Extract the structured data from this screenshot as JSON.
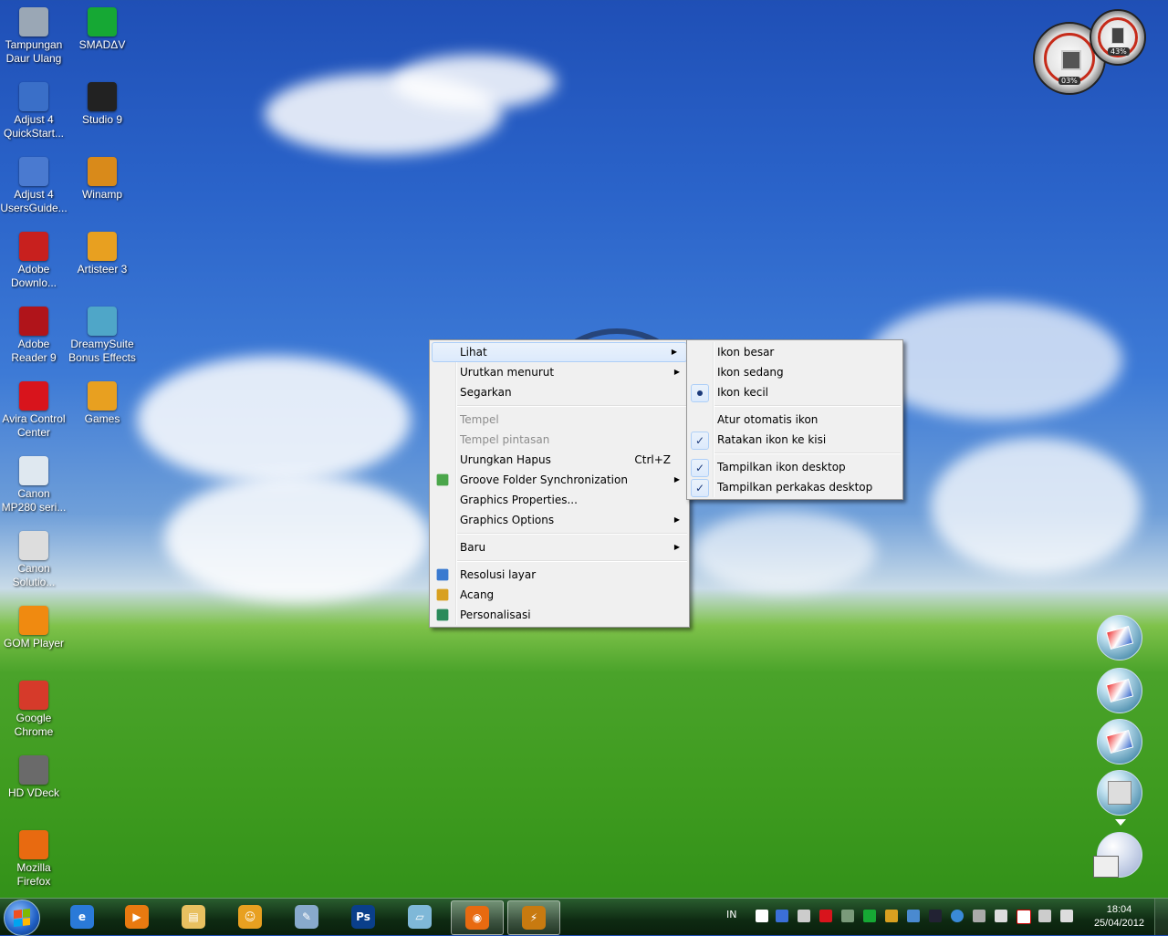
{
  "desktop_icons": [
    {
      "label": "Tampungan Daur Ulang",
      "icon": "recycle-bin-icon",
      "color": "#9aa7b5"
    },
    {
      "label": "SMADΔV",
      "icon": "smadav-icon",
      "color": "#16a834"
    },
    {
      "label": "Adjust 4 QuickStart...",
      "icon": "document-shortcut-icon",
      "color": "#3a6fc8"
    },
    {
      "label": "Studio 9",
      "icon": "clapperboard-icon",
      "color": "#222222"
    },
    {
      "label": "Adjust 4 UsersGuide...",
      "icon": "document-shortcut-icon",
      "color": "#4a7ad0"
    },
    {
      "label": "Winamp",
      "icon": "winamp-icon",
      "color": "#d98a1a"
    },
    {
      "label": "Adobe Downlo...",
      "icon": "adobe-download-icon",
      "color": "#c8201e"
    },
    {
      "label": "Artisteer 3",
      "icon": "palette-icon",
      "color": "#e8a020"
    },
    {
      "label": "Adobe Reader 9",
      "icon": "adobe-reader-icon",
      "color": "#b0141a"
    },
    {
      "label": "DreamySuite Bonus Effects",
      "icon": "dreamysuite-icon",
      "color": "#4fa6c8"
    },
    {
      "label": "Avira Control Center",
      "icon": "avira-icon",
      "color": "#d8141c"
    },
    {
      "label": "Games",
      "icon": "games-icon",
      "color": "#e8a020"
    },
    {
      "label": "Canon MP280 seri...",
      "icon": "canon-printer-icon",
      "color": "#dfe8f0"
    },
    {
      "label": "Canon Solutio...",
      "icon": "canon-solution-icon",
      "color": "#dddddd"
    },
    {
      "label": "GOM Player",
      "icon": "gom-player-icon",
      "color": "#f08a10"
    },
    {
      "label": "Google Chrome",
      "icon": "chrome-icon",
      "color": "#d63a2a"
    },
    {
      "label": "HD VDeck",
      "icon": "vdeck-icon",
      "color": "#6a6a6a"
    },
    {
      "label": "Mozilla Firefox",
      "icon": "firefox-icon",
      "color": "#e86a10"
    }
  ],
  "gadgets": {
    "cpu_value": "03%",
    "ram_value": "43%"
  },
  "context_menu": {
    "items": [
      {
        "label": "Lihat",
        "submenu": true,
        "highlight": true
      },
      {
        "label": "Urutkan menurut",
        "submenu": true
      },
      {
        "label": "Segarkan"
      },
      {
        "separator": true
      },
      {
        "label": "Tempel",
        "disabled": true
      },
      {
        "label": "Tempel pintasan",
        "disabled": true
      },
      {
        "label": "Urungkan Hapus",
        "shortcut": "Ctrl+Z"
      },
      {
        "label": "Groove Folder Synchronization",
        "submenu": true,
        "icon": "groove-icon"
      },
      {
        "label": "Graphics Properties..."
      },
      {
        "label": "Graphics Options",
        "submenu": true
      },
      {
        "separator": true
      },
      {
        "label": "Baru",
        "submenu": true
      },
      {
        "separator": true
      },
      {
        "label": "Resolusi layar",
        "icon": "screen-resolution-icon"
      },
      {
        "label": "Acang",
        "icon": "gadgets-icon"
      },
      {
        "label": "Personalisasi",
        "icon": "personalize-icon"
      }
    ]
  },
  "submenu_lihat": {
    "items": [
      {
        "label": "Ikon besar"
      },
      {
        "label": "Ikon sedang"
      },
      {
        "label": "Ikon kecil",
        "mark": "dot"
      },
      {
        "separator": true
      },
      {
        "label": "Atur otomatis ikon"
      },
      {
        "label": "Ratakan ikon ke kisi",
        "mark": "check"
      },
      {
        "separator": true
      },
      {
        "label": "Tampilkan ikon desktop",
        "mark": "check"
      },
      {
        "label": "Tampilkan perkakas desktop",
        "mark": "check"
      }
    ]
  },
  "taskbar": {
    "pinned": [
      {
        "name": "internet-explorer",
        "color": "#2a7ad8",
        "glyph": "e"
      },
      {
        "name": "media-player",
        "color": "#e87a10",
        "glyph": "▶"
      },
      {
        "name": "file-explorer",
        "color": "#e8c060",
        "glyph": "▤"
      },
      {
        "name": "games-app",
        "color": "#e8a020",
        "glyph": "☺"
      },
      {
        "name": "paint-app",
        "color": "#8ac",
        "glyph": "✎"
      },
      {
        "name": "photoshop",
        "color": "#0a3f8a",
        "glyph": "Ps"
      },
      {
        "name": "notes-app",
        "color": "#7fb8d8",
        "glyph": "▱"
      },
      {
        "name": "firefox",
        "color": "#e86a10",
        "glyph": "◉",
        "active": true
      },
      {
        "name": "winamp",
        "color": "#c87a10",
        "glyph": "⚡",
        "active": true
      }
    ],
    "language": "IN",
    "time": "18:04",
    "date": "25/04/2012"
  }
}
